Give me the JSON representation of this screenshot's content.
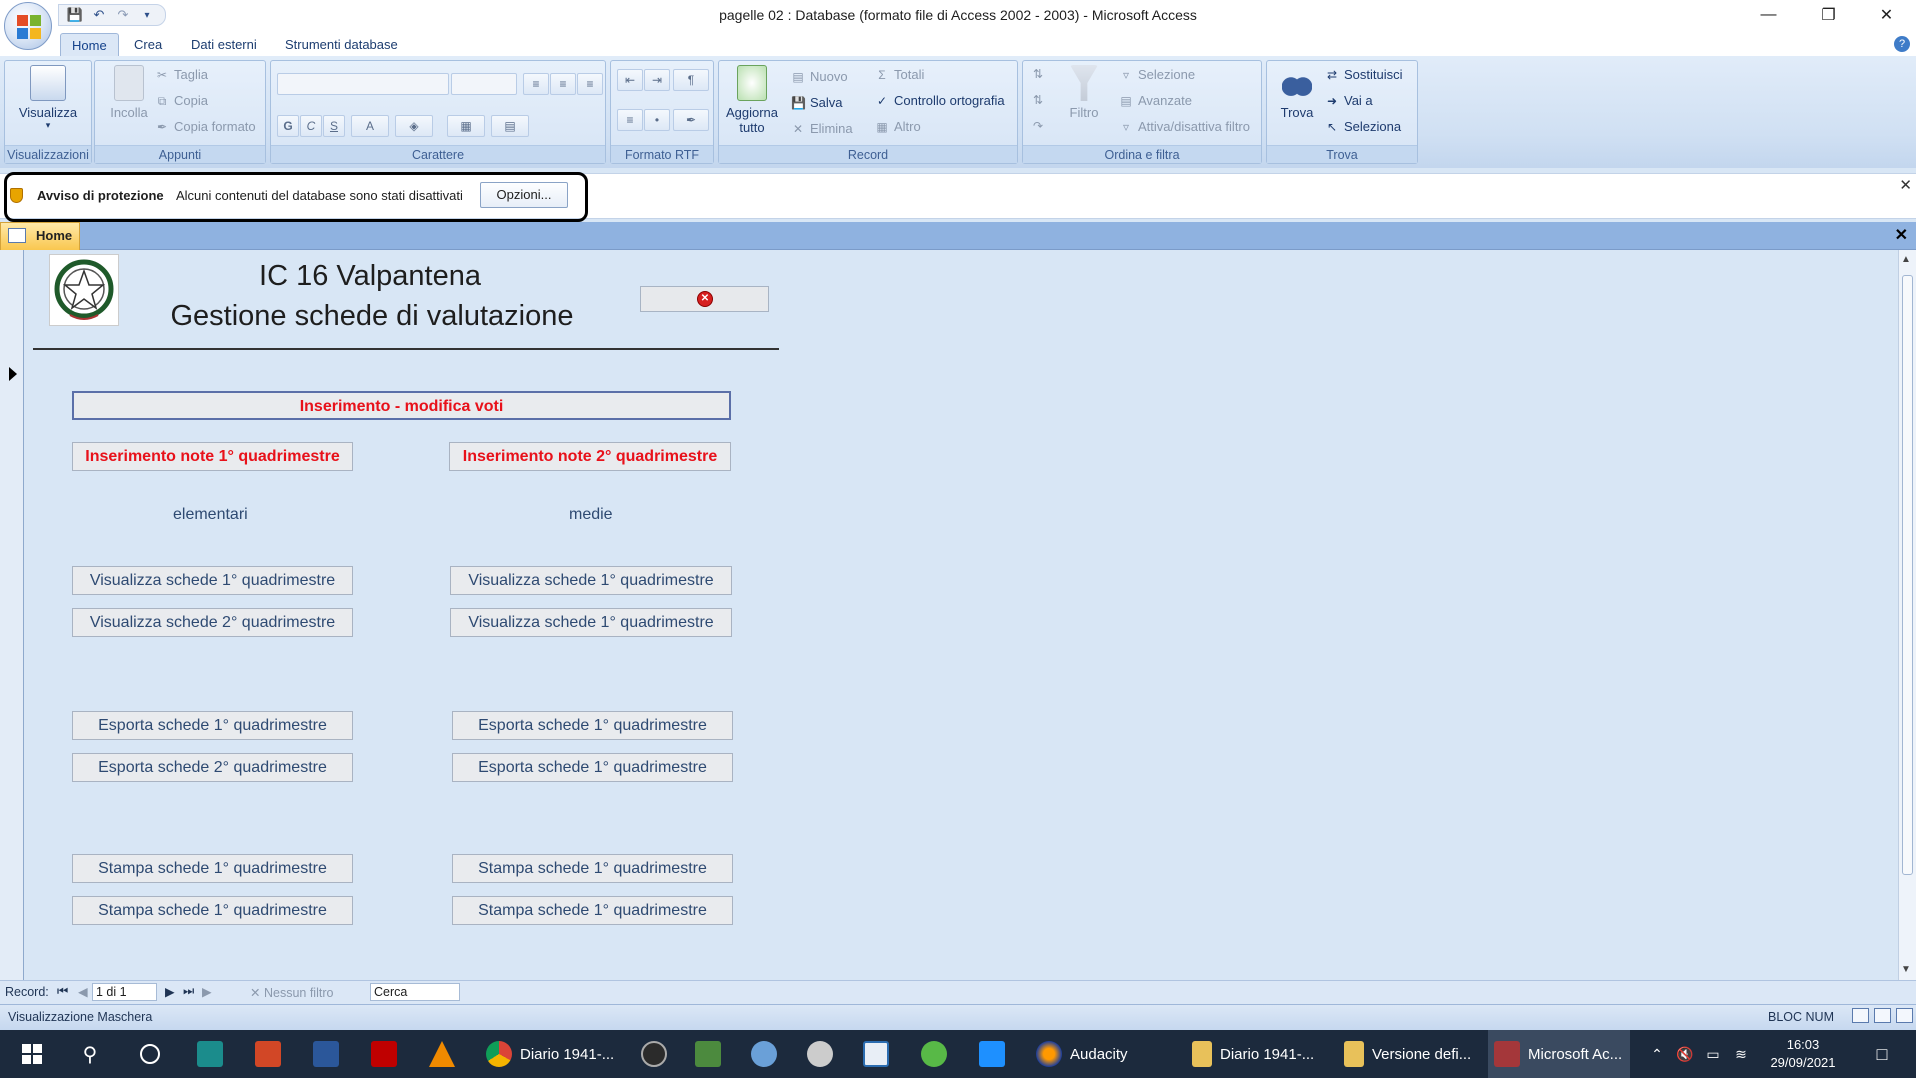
{
  "window": {
    "title": "pagelle 02 : Database (formato file di Access 2002 - 2003) - Microsoft Access",
    "minimize": "—",
    "restore": "❐",
    "close": "✕"
  },
  "tabs": [
    "Home",
    "Crea",
    "Dati esterni",
    "Strumenti database"
  ],
  "help": "?",
  "ribbon": {
    "views": {
      "label": "Visualizza",
      "group": "Visualizzazioni"
    },
    "clipboard": {
      "paste": "Incolla",
      "cut": "Taglia",
      "copy": "Copia",
      "format_painter": "Copia formato",
      "group": "Appunti"
    },
    "font": {
      "bold": "G",
      "italic": "C",
      "underline": "S",
      "font_color": "A",
      "group": "Carattere"
    },
    "rtf": {
      "group": "Formato RTF"
    },
    "records": {
      "refresh_line1": "Aggiorna",
      "refresh_line2": "tutto",
      "new": "Nuovo",
      "save": "Salva",
      "delete": "Elimina",
      "totals": "Totali",
      "spelling": "Controllo ortografia",
      "more": "Altro",
      "group": "Record"
    },
    "sort": {
      "filter": "Filtro",
      "selection": "Selezione",
      "advanced": "Avanzate",
      "toggle_filter": "Attiva/disattiva filtro",
      "group": "Ordina e filtra"
    },
    "find": {
      "find": "Trova",
      "replace": "Sostituisci",
      "goto": "Vai a",
      "select": "Seleziona",
      "group": "Trova"
    }
  },
  "security": {
    "title": "Avviso di protezione",
    "message": "Alcuni contenuti del database sono stati disattivati",
    "options": "Opzioni...",
    "close": "✕"
  },
  "doc_tab": {
    "label": "Home",
    "close": "✕"
  },
  "form": {
    "title1": "IC 16 Valpantena",
    "title2": "Gestione schede di valutazione",
    "btn_insert_votes": "Inserimento - modifica voti",
    "btn_notes_1": "Inserimento note 1° quadrimestre",
    "btn_notes_2": "Inserimento note 2° quadrimestre",
    "label_elementari": "elementari",
    "label_medie": "medie",
    "left": {
      "view1": "Visualizza schede 1° quadrimestre",
      "view2": "Visualizza schede 2° quadrimestre",
      "export1": "Esporta schede 1° quadrimestre",
      "export2": "Esporta schede 2° quadrimestre",
      "print1": "Stampa schede 1° quadrimestre",
      "print2": "Stampa schede 1° quadrimestre"
    },
    "right": {
      "view1": "Visualizza schede 1° quadrimestre",
      "view2": "Visualizza schede 1° quadrimestre",
      "export1": "Esporta schede 1° quadrimestre",
      "export2": "Esporta schede 1° quadrimestre",
      "print1": "Stampa schede 1° quadrimestre",
      "print2": "Stampa schede 1° quadrimestre"
    }
  },
  "nav": {
    "record_label": "Record:",
    "position": "1 di 1",
    "no_filter": "Nessun filtro",
    "search": "Cerca"
  },
  "status": {
    "view": "Visualizzazione Maschera",
    "num_lock": "BLOC NUM"
  },
  "taskbar": {
    "item_diario1": "Diario 1941-...",
    "item_audacity": "Audacity",
    "item_diario2": "Diario 1941-...",
    "item_versione": "Versione defi...",
    "item_access": "Microsoft Ac...",
    "time": "16:03",
    "date": "29/09/2021"
  }
}
